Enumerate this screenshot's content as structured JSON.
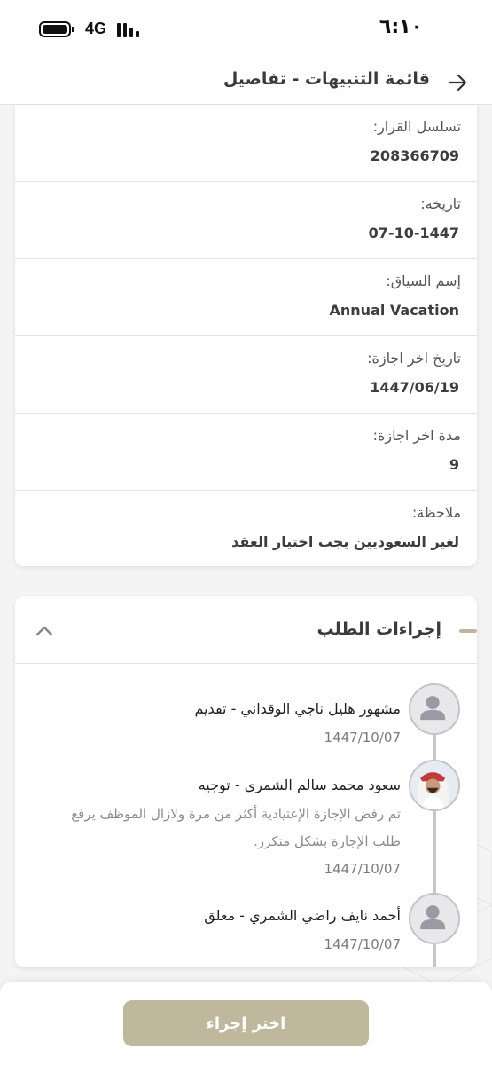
{
  "status_bar": {
    "time": "٦:١٠",
    "network": "4G"
  },
  "header": {
    "title": "قائمة التنبيهات - تفاصيل",
    "back_icon": "arrow-right-icon"
  },
  "details": [
    {
      "label": "تسلسل القرار:",
      "value": "208366709"
    },
    {
      "label": "تاريخه:",
      "value": "07-10-1447"
    },
    {
      "label": "إسم السياق:",
      "value": "Annual Vacation"
    },
    {
      "label": "تاريخ اخر اجازة:",
      "value": "1447/06/19"
    },
    {
      "label": "مدة اخر اجازة:",
      "value": "9"
    },
    {
      "label": "ملاحظة:",
      "value": "لغير السعوديين يجب اختيار العقد"
    }
  ],
  "actions": {
    "title": "إجراءات الطلب",
    "collapse_icon": "chevron-up-icon",
    "entries": [
      {
        "name": "مشهور هليل ناجي الوقداني - تقديم",
        "date": "1447/10/07",
        "note": "",
        "avatar": "person-placeholder-icon"
      },
      {
        "name": "سعود محمد سالم الشمري - توجيه",
        "date": "1447/10/07",
        "note": "تم رفض الإجازة الإعتيادية أكثر من مرة ولازال الموظف يرفع طلب الإجازة بشكل متكرر.",
        "avatar": "user-photo"
      },
      {
        "name": "أحمد نايف راضي الشمري - معلق",
        "date": "1447/10/07",
        "note": "",
        "avatar": "person-placeholder-icon"
      }
    ]
  },
  "footer": {
    "button_label": "اختر إجراء"
  },
  "colors": {
    "accent": "#bfb89c",
    "text_primary": "#2b2b2b",
    "divider": "#e3e3e3"
  }
}
